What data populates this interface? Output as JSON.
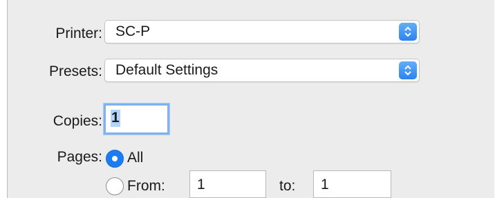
{
  "printer": {
    "label": "Printer:",
    "value": "SC-P",
    "control_icon": "updown-chevrons-icon"
  },
  "presets": {
    "label": "Presets:",
    "value": "Default Settings",
    "control_icon": "updown-chevrons-icon"
  },
  "copies": {
    "label": "Copies:",
    "value": "1"
  },
  "pages": {
    "label": "Pages:",
    "all_label": "All",
    "all_selected": true,
    "from_label": "From:",
    "from_value": "1",
    "to_label": "to:",
    "to_value": "1"
  },
  "colors": {
    "accent": "#1e7cf2",
    "background": "#ececec",
    "focus_ring": "#7fb2ee"
  }
}
